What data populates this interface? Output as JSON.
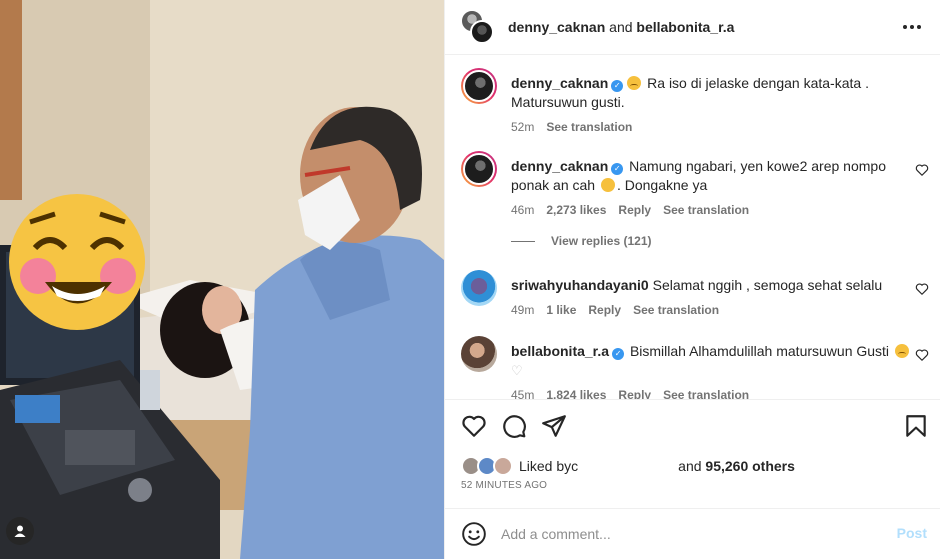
{
  "header": {
    "user1": "denny_caknan",
    "joiner": " and ",
    "user2": "bellabonita_r.a",
    "more_icon": "more-horizontal-icon"
  },
  "comments": [
    {
      "user": "denny_caknan",
      "verified": true,
      "text": "Ra iso di jelaske dengan kata-kata . Matursuwun gusti.",
      "time": "52m",
      "likes": "",
      "reply": "",
      "translate": "See translation"
    },
    {
      "user": "denny_caknan",
      "verified": true,
      "text_before": "Namung ngabari, yen kowe2 arep nompo ponak an cah",
      "text_after": ". Dongakne ya",
      "time": "46m",
      "likes": "2,273 likes",
      "reply": "Reply",
      "translate": "See translation"
    },
    {
      "user": "sriwahyuhandayani0",
      "verified": false,
      "text": "Selamat nggih , semoga sehat selalu",
      "time": "49m",
      "likes": "1 like",
      "reply": "Reply",
      "translate": "See translation"
    },
    {
      "user": "bellabonita_r.a",
      "verified": true,
      "text": "Bismillah Alhamdulillah matursuwun Gusti",
      "time": "45m",
      "likes": "1,824 likes",
      "reply": "Reply",
      "translate": "See translation"
    }
  ],
  "view_replies": "View replies (121)",
  "likes_line": {
    "prefix": "Liked by ",
    "partial_name": "c",
    "and": "and ",
    "others": "95,260 others"
  },
  "timestamp": "52 MINUTES AGO",
  "add_comment": {
    "placeholder": "Add a comment...",
    "post_label": "Post"
  },
  "icons": {
    "like": "heart-icon",
    "comment": "comment-icon",
    "share": "send-icon",
    "save": "bookmark-icon",
    "emoji": "smiley-icon",
    "user": "user-tag-icon"
  },
  "colors": {
    "link_blue": "#3897f0",
    "post_disabled": "#b2dffc",
    "muted": "#737373"
  }
}
